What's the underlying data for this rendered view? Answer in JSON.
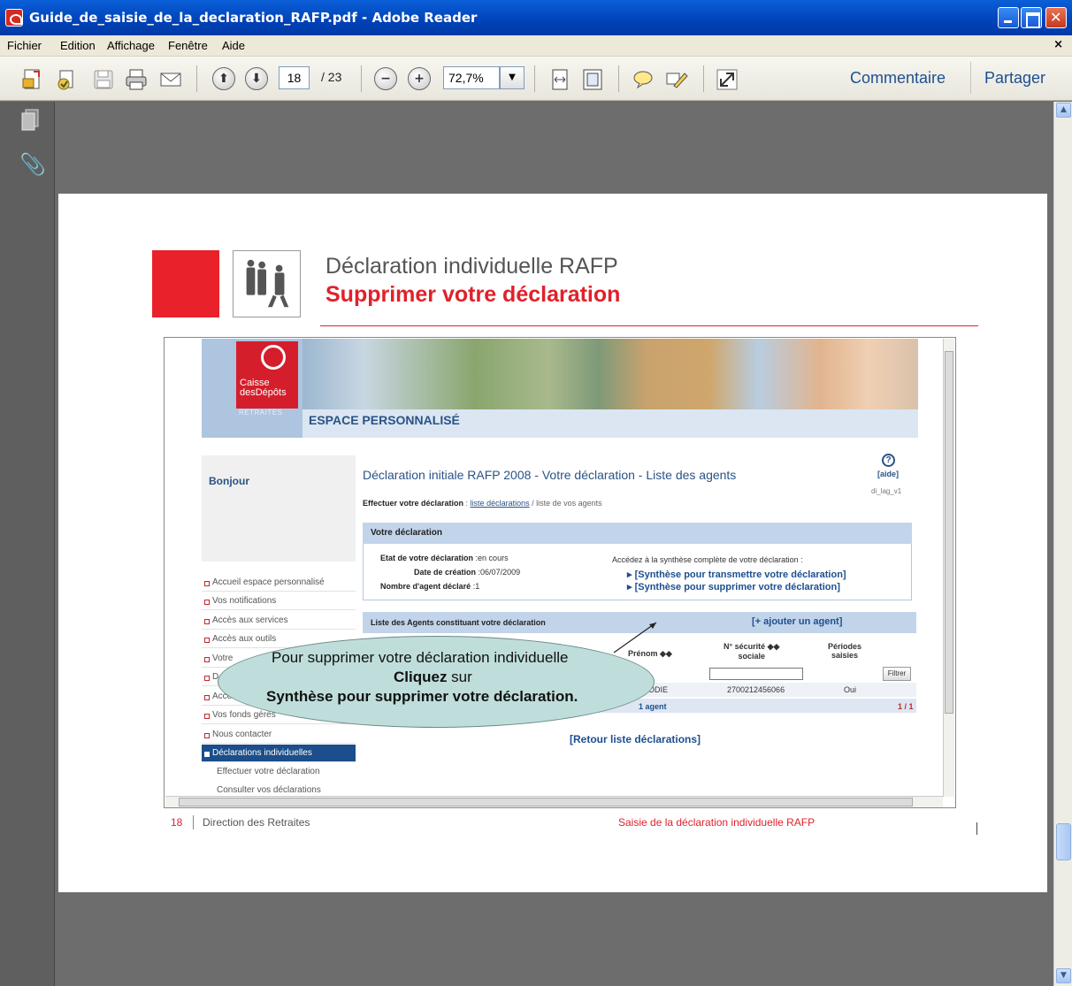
{
  "window": {
    "title": "Guide_de_saisie_de_la_declaration_RAFP.pdf - Adobe Reader"
  },
  "menu": [
    "Fichier",
    "Edition",
    "Affichage",
    "Fenêtre",
    "Aide"
  ],
  "toolbar": {
    "page_current": "18",
    "page_total": "/ 23",
    "zoom": "72,7%",
    "comment_label": "Commentaire",
    "share_label": "Partager"
  },
  "doc": {
    "title": "Déclaration individuelle RAFP",
    "subtitle": "Supprimer votre déclaration",
    "footer_page": "18",
    "footer_left": "Direction des Retraites",
    "footer_right": "Saisie de la déclaration individuelle RAFP"
  },
  "site": {
    "logo_line1": "Caisse",
    "logo_line2": "desDépôts",
    "retraites": "RETRAITES",
    "espace": "ESPACE PERSONNALISÉ",
    "bonjour": "Bonjour",
    "sidebar": [
      "Accueil espace personnalisé",
      "Vos notifications",
      "Accès aux services",
      "Accès aux outils",
      "Votre",
      "D",
      "Accè",
      "Vos fonds gérés",
      "Nous contacter",
      "Déclarations individuelles"
    ],
    "sidebar_sub": [
      "Effectuer votre déclaration",
      "Consulter vos déclarations"
    ],
    "main_title": "Déclaration initiale RAFP 2008 - Votre déclaration - Liste des agents",
    "help": "[aide]",
    "code": "di_lag_v1",
    "breadcrumb_bold": "Effectuer votre déclaration",
    "breadcrumb_link": "liste déclarations",
    "breadcrumb_rest": "/ liste de vos agents",
    "box1_title": "Votre déclaration",
    "etat_label": "Etat de votre déclaration",
    "etat_value": ":en cours",
    "date_label": "Date de création",
    "date_value": ":06/07/2009",
    "nombre_label": "Nombre d'agent déclaré",
    "nombre_value": ":1",
    "synthese_intro": "Accédez à la synthèse complète de votre déclaration :",
    "synthese_transmettre": "▸ [Synthèse pour transmettre votre déclaration]",
    "synthese_supprimer": "▸ [Synthèse pour supprimer votre déclaration]",
    "box2_title": "Liste des Agents constituant votre déclaration",
    "add_agent": "[+ ajouter un agent]",
    "col_prenom": "Prénom ◆◆",
    "col_nss_1": "N° sécurité ◆◆",
    "col_nss_2": "sociale",
    "col_periodes_1": "Périodes",
    "col_periodes_2": "saisies",
    "filter": "Filtrer",
    "row_prenom": "ODIE",
    "row_nss": "2700212456066",
    "row_periodes": "Oui",
    "agent_count": "1 agent",
    "pagination": "1 / 1",
    "retour": "[Retour liste déclarations]"
  },
  "callout": {
    "line1": "Pour supprimer  votre déclaration individuelle",
    "line2_bold": "Cliquez",
    "line2_rest": " sur",
    "line3": "Synthèse pour supprimer votre déclaration."
  }
}
